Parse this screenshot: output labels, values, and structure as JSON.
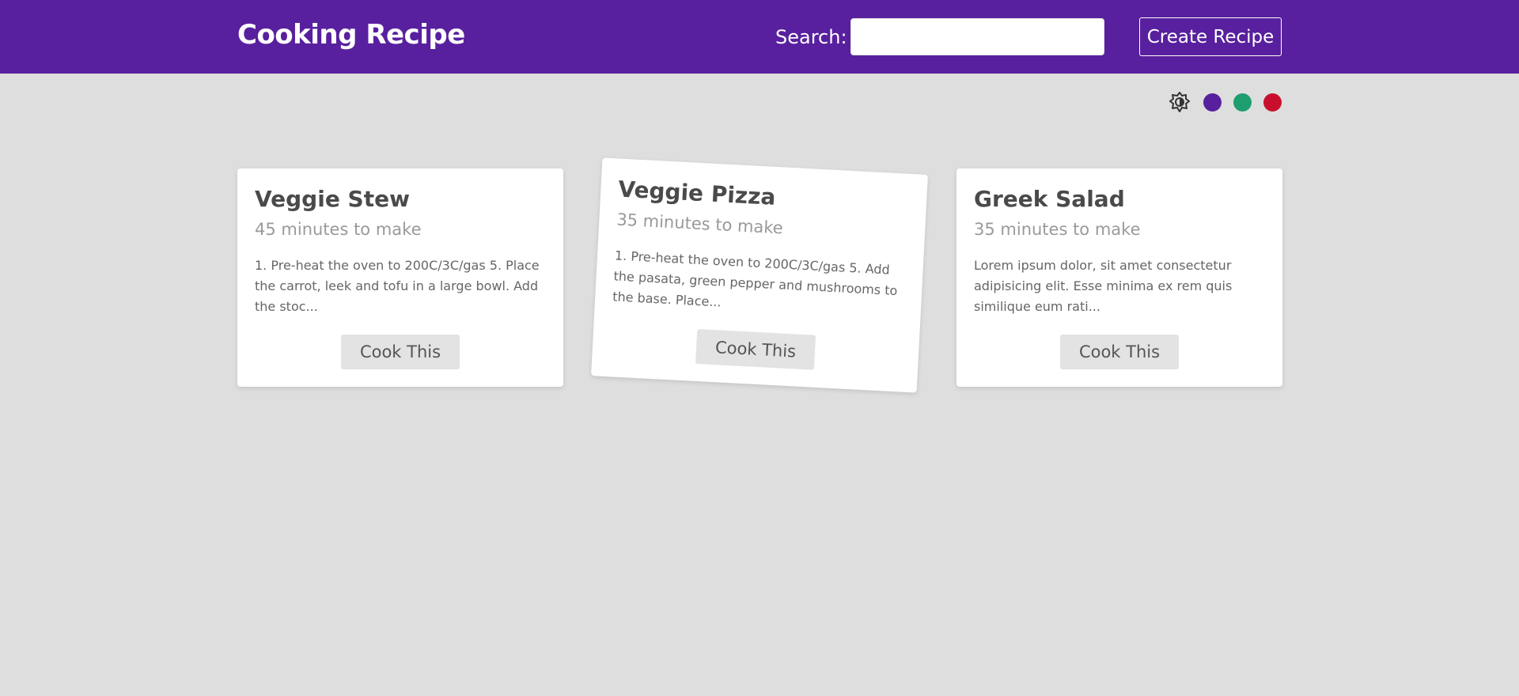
{
  "header": {
    "brand": "Cooking Recipe",
    "search_label": "Search:",
    "search_value": "",
    "search_placeholder": "",
    "create_button": "Create Recipe"
  },
  "theme": {
    "icon": "brightness-icon",
    "colors": [
      "#58209e",
      "#1e9e6e",
      "#c8102e"
    ]
  },
  "recipes": [
    {
      "title": "Veggie Stew",
      "time": "45 minutes to make",
      "description": "1. Pre-heat the oven to 200C/3C/gas 5. Place the carrot, leek and tofu in a large bowl. Add the stoc...",
      "button": "Cook This"
    },
    {
      "title": "Veggie Pizza",
      "time": "35 minutes to make",
      "description": "1. Pre-heat the oven to 200C/3C/gas 5. Add the pasata, green pepper and mushrooms to the base. Place...",
      "button": "Cook This"
    },
    {
      "title": "Greek Salad",
      "time": "35 minutes to make",
      "description": "Lorem ipsum dolor, sit amet consectetur adipisicing elit. Esse minima ex rem quis similique eum rati...",
      "button": "Cook This"
    }
  ]
}
